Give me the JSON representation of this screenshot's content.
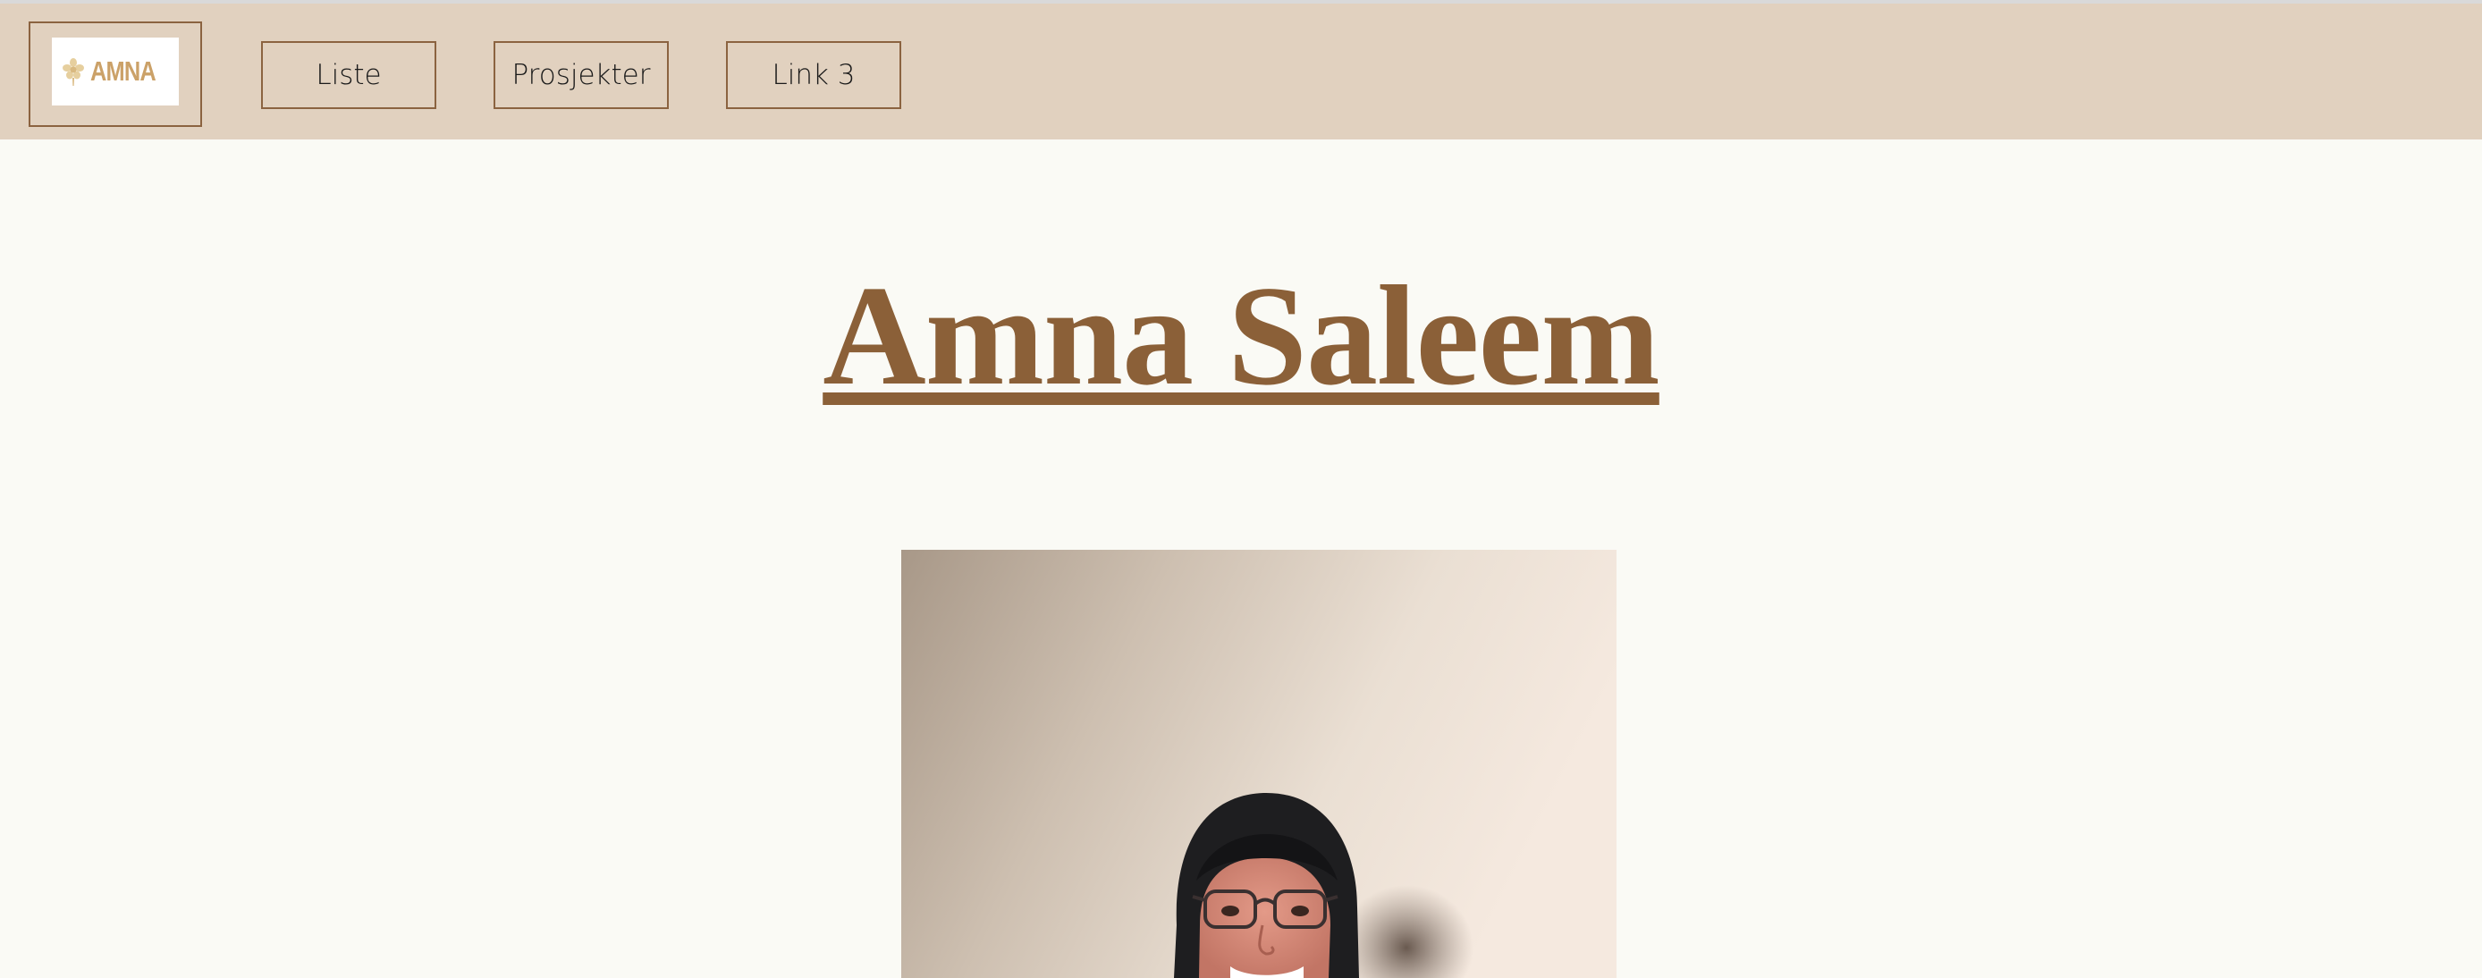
{
  "nav": {
    "logo_text": "AMNA",
    "logo_icon": "flower-icon",
    "items": [
      {
        "label": "Liste"
      },
      {
        "label": "Prosjekter"
      },
      {
        "label": "Link 3"
      }
    ]
  },
  "main": {
    "title": "Amna Saleem",
    "photo_icon": "portrait-photo"
  },
  "colors": {
    "topbar": "#e1d1bf",
    "accent_brown": "#8b6038",
    "page_bg": "#fafaf5",
    "logo_gold": "#cba168"
  }
}
